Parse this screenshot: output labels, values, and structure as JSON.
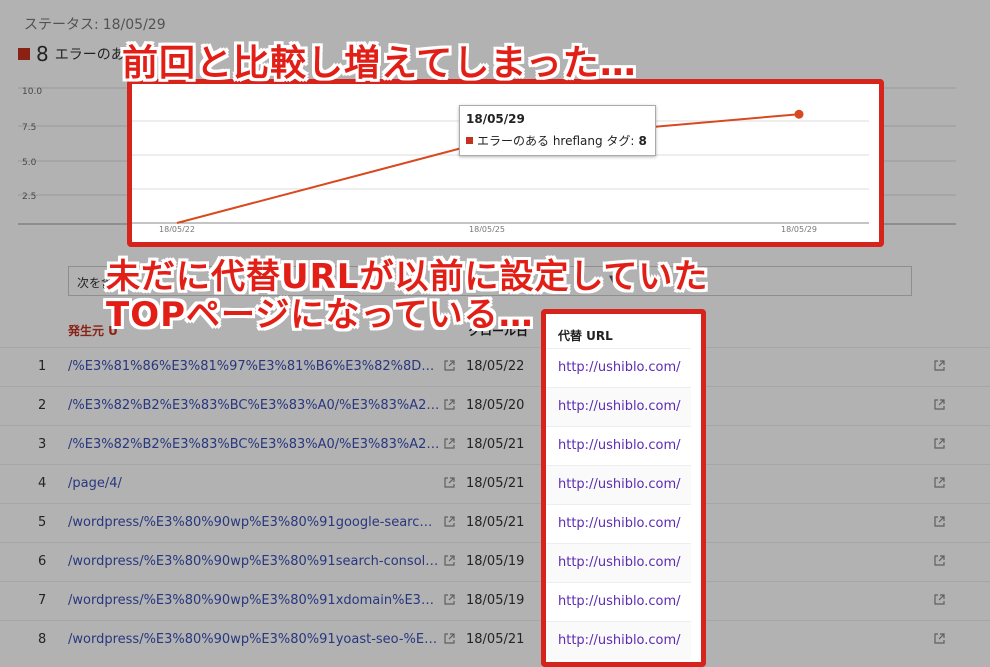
{
  "status": {
    "label": "ステータス:",
    "date": "18/05/29"
  },
  "summary": {
    "count": "8",
    "label": "エラーのある..."
  },
  "callouts": {
    "top": "前回と比較し増えてしまった…",
    "middle_line1": "未だに代替URLが以前に設定していた",
    "middle_line2": "TOPページになっている…"
  },
  "chart_data": {
    "type": "line",
    "x": [
      "18/05/22",
      "18/05/25",
      "18/05/29"
    ],
    "series": [
      {
        "name": "エラーのある hreflang タグ",
        "values": [
          0,
          6,
          8
        ]
      }
    ],
    "y_ticks": [
      "2.5",
      "5.0",
      "7.5",
      "10.0"
    ],
    "ylim": [
      0,
      10
    ],
    "color": "#d9481f"
  },
  "tooltip": {
    "title": "18/05/29",
    "series": "エラーのある hreflang タグ:",
    "value": "8"
  },
  "filter": {
    "label": "次を含"
  },
  "columns": {
    "source": "発生元 U",
    "crawl": "クロール日",
    "alt": "代替 URL"
  },
  "rows": [
    {
      "idx": "1",
      "url": "/%E3%81%86%E3%81%97%E3%81%B6%E3%82%8D%E3...",
      "date": "18/05/22",
      "alt": "http://ushiblo.com/"
    },
    {
      "idx": "2",
      "url": "/%E3%82%B2%E3%83%BC%E3%83%A0/%E3%83%A2%E...",
      "date": "18/05/20",
      "alt": "http://ushiblo.com/"
    },
    {
      "idx": "3",
      "url": "/%E3%82%B2%E3%83%BC%E3%83%A0/%E3%83%A2%E...",
      "date": "18/05/21",
      "alt": "http://ushiblo.com/"
    },
    {
      "idx": "4",
      "url": "/page/4/",
      "date": "18/05/21",
      "alt": "http://ushiblo.com/"
    },
    {
      "idx": "5",
      "url": "/wordpress/%E3%80%90wp%E3%80%91google-search-con...",
      "date": "18/05/21",
      "alt": "http://ushiblo.com/"
    },
    {
      "idx": "6",
      "url": "/wordpress/%E3%80%90wp%E3%80%91search-console%E...",
      "date": "18/05/19",
      "alt": "http://ushiblo.com/"
    },
    {
      "idx": "7",
      "url": "/wordpress/%E3%80%90wp%E3%80%91xdomain%E3%81...",
      "date": "18/05/19",
      "alt": "http://ushiblo.com/"
    },
    {
      "idx": "8",
      "url": "/wordpress/%E3%80%90wp%E3%80%91yoast-seo-%E3%8...",
      "date": "18/05/21",
      "alt": "http://ushiblo.com/"
    }
  ],
  "icons": {
    "external": "external-link-icon"
  }
}
